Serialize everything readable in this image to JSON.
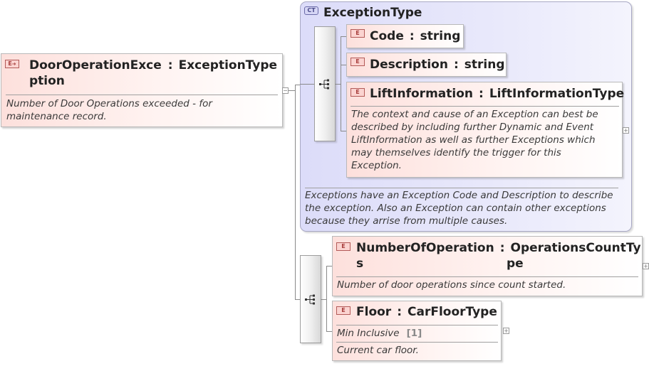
{
  "root": {
    "badge": "E",
    "name_line1": "DoorOperationExce",
    "name_line2": "ption",
    "separator": ":",
    "type": "ExceptionType",
    "doc": "Number of Door Operations exceeded - for maintenance record."
  },
  "exception_type": {
    "badge": "CT",
    "title": "ExceptionType",
    "doc": "Exceptions have an Exception Code and Description to describe the exception. Also an Exception can contain other exceptions because they arrise from multiple causes.",
    "elements": [
      {
        "badge": "E",
        "name": "Code",
        "separator": ":",
        "type": "string"
      },
      {
        "badge": "E",
        "name": "Description",
        "separator": ":",
        "type": "string"
      },
      {
        "badge": "E",
        "name": "LiftInformation",
        "separator": ":",
        "type": "LiftInformationType",
        "doc": "The context and cause of an Exception can best be described by including further Dynamic and Event LiftInformation as well as further Exceptions which may themselves identify the trigger for this Exception."
      }
    ]
  },
  "number_of_operations": {
    "badge": "E",
    "name_line1": "NumberOfOperation",
    "name_line2": "s",
    "separator": ":",
    "type_line1": "OperationsCountTy",
    "type_line2": "pe",
    "doc": "Number of door operations since count started."
  },
  "floor": {
    "badge": "E",
    "name": "Floor",
    "separator": ":",
    "type": "CarFloorType",
    "facet_label": "Min Inclusive",
    "facet_value": "[1]",
    "doc": "Current car floor."
  },
  "icons": {
    "badge_arrow": "arrow-icon",
    "sequence": "sequence-icon",
    "expand": "plus-icon",
    "collapse": "minus-icon"
  }
}
